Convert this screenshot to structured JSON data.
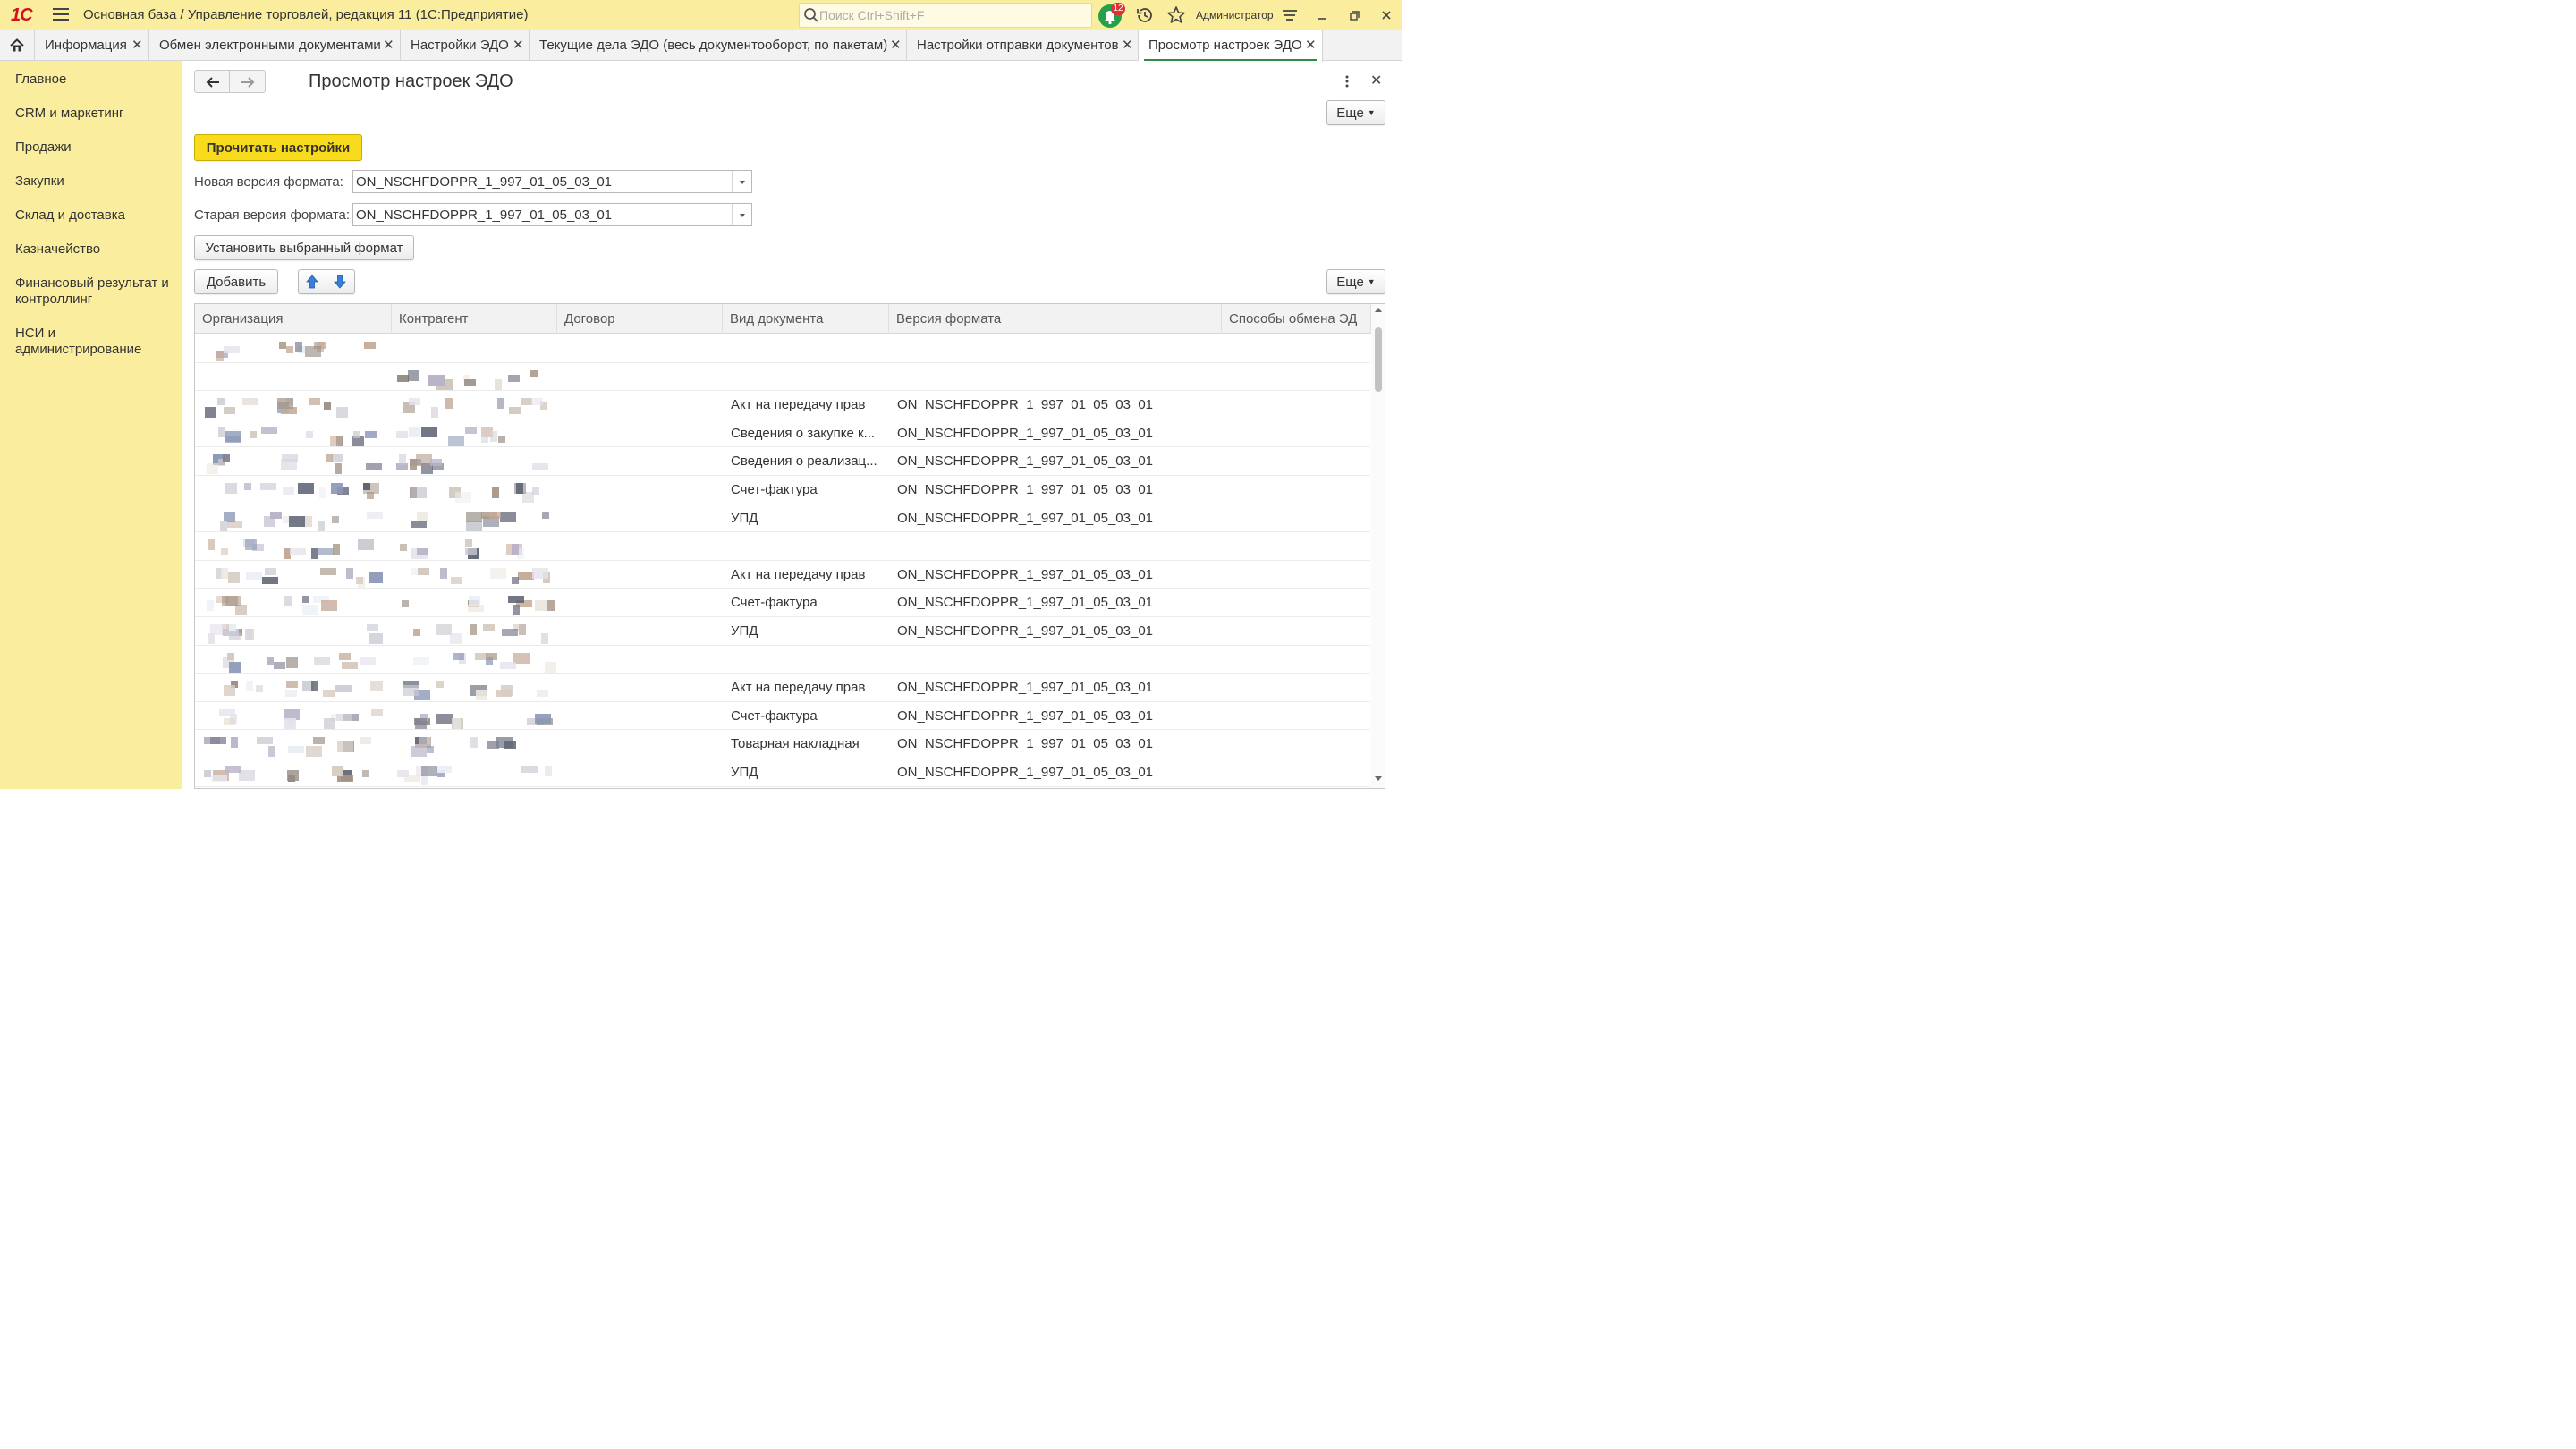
{
  "window": {
    "logo": "1С",
    "title": "Основная база / Управление торговлей, редакция 11  (1С:Предприятие)",
    "search_placeholder": "Поиск Ctrl+Shift+F",
    "notifications_count": "12",
    "user": "Администратор"
  },
  "tabs": [
    {
      "label": "Информация"
    },
    {
      "label": "Обмен электронными документами"
    },
    {
      "label": "Настройки ЭДО"
    },
    {
      "label": "Текущие дела ЭДО (весь документооборот, по пакетам)"
    },
    {
      "label": "Настройки отправки документов"
    },
    {
      "label": "Просмотр настроек ЭДО",
      "active": true
    }
  ],
  "sidebar": {
    "items": [
      {
        "label": "Главное"
      },
      {
        "label": "CRM и маркетинг"
      },
      {
        "label": "Продажи"
      },
      {
        "label": "Закупки"
      },
      {
        "label": "Склад и доставка"
      },
      {
        "label": "Казначейство"
      },
      {
        "label": "Финансовый результат и контроллинг"
      },
      {
        "label": "НСИ и администрирование"
      }
    ]
  },
  "form": {
    "title": "Просмотр настроек ЭДО",
    "more_label": "Еще",
    "read_button": "Прочитать настройки",
    "new_format_label": "Новая версия формата:",
    "new_format_value": "ON_NSCHFDOPPR_1_997_01_05_03_01",
    "old_format_label": "Старая версия формата:",
    "old_format_value": "ON_NSCHFDOPPR_1_997_01_05_03_01",
    "set_format_button": "Установить выбранный формат",
    "add_button": "Добавить",
    "table_more_label": "Еще"
  },
  "table": {
    "columns": [
      "Организация",
      "Контрагент",
      "Договор",
      "Вид документа",
      "Версия формата",
      "Способы обмена ЭД"
    ],
    "rows": [
      {
        "doc": "",
        "format": ""
      },
      {
        "doc": "",
        "format": ""
      },
      {
        "doc": "Акт на передачу прав",
        "format": "ON_NSCHFDOPPR_1_997_01_05_03_01"
      },
      {
        "doc": "Сведения о закупке к...",
        "format": "ON_NSCHFDOPPR_1_997_01_05_03_01"
      },
      {
        "doc": "Сведения о реализац...",
        "format": "ON_NSCHFDOPPR_1_997_01_05_03_01"
      },
      {
        "doc": "Счет-фактура",
        "format": "ON_NSCHFDOPPR_1_997_01_05_03_01"
      },
      {
        "doc": "УПД",
        "format": "ON_NSCHFDOPPR_1_997_01_05_03_01"
      },
      {
        "doc": "",
        "format": ""
      },
      {
        "doc": "Акт на передачу прав",
        "format": "ON_NSCHFDOPPR_1_997_01_05_03_01"
      },
      {
        "doc": "Счет-фактура",
        "format": "ON_NSCHFDOPPR_1_997_01_05_03_01"
      },
      {
        "doc": "УПД",
        "format": "ON_NSCHFDOPPR_1_997_01_05_03_01"
      },
      {
        "doc": "",
        "format": ""
      },
      {
        "doc": "Акт на передачу прав",
        "format": "ON_NSCHFDOPPR_1_997_01_05_03_01"
      },
      {
        "doc": "Счет-фактура",
        "format": "ON_NSCHFDOPPR_1_997_01_05_03_01"
      },
      {
        "doc": "Товарная накладная",
        "format": "ON_NSCHFDOPPR_1_997_01_05_03_01"
      },
      {
        "doc": "УПД",
        "format": "ON_NSCHFDOPPR_1_997_01_05_03_01"
      }
    ]
  },
  "colors": {
    "panel_yellow": "#fbed9e",
    "primary_button": "#f7db1c",
    "active_tab_underline": "#2e8c4a",
    "notification_green": "#23a04a",
    "badge_red": "#e03030",
    "logo_red": "#d0121b"
  },
  "icons": [
    "home-icon",
    "hamburger-icon",
    "search-icon",
    "bell-icon",
    "history-icon",
    "star-icon",
    "settings-icon",
    "minimize-icon",
    "maximize-icon",
    "close-icon",
    "arrow-left-icon",
    "arrow-right-icon",
    "more-vertical-icon",
    "arrow-up-icon",
    "arrow-down-icon"
  ]
}
